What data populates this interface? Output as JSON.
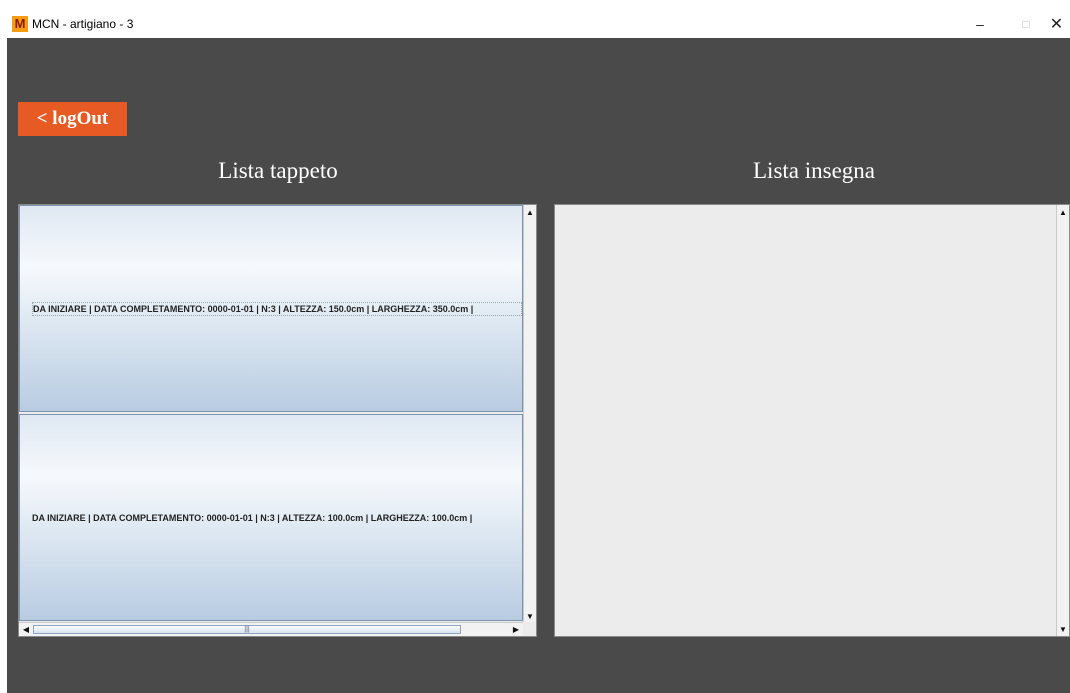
{
  "window": {
    "title": "MCN - artigiano - 3",
    "app_icon_letter": "M",
    "controls": {
      "minimize": "–",
      "maximize": "□",
      "close": "✕"
    }
  },
  "toolbar": {
    "logout_label": "< logOut"
  },
  "headings": {
    "left": "Lista tappeto",
    "right": "Lista insegna"
  },
  "lists": {
    "tappeto": [
      {
        "text": "DA INIZIARE | DATA COMPLETAMENTO: 0000-01-01 | N:3 | ALTEZZA: 150.0cm | LARGHEZZA: 350.0cm |"
      },
      {
        "text": "DA INIZIARE | DATA COMPLETAMENTO: 0000-01-01 | N:3 | ALTEZZA: 100.0cm | LARGHEZZA: 100.0cm |"
      }
    ],
    "insegna": []
  },
  "icons": {
    "scroll_up": "▲",
    "scroll_down": "▼",
    "scroll_left": "◀",
    "scroll_right": "▶",
    "thumb_grip": "|||"
  },
  "colors": {
    "background": "#4a4a4a",
    "accent": "#e85a23"
  }
}
